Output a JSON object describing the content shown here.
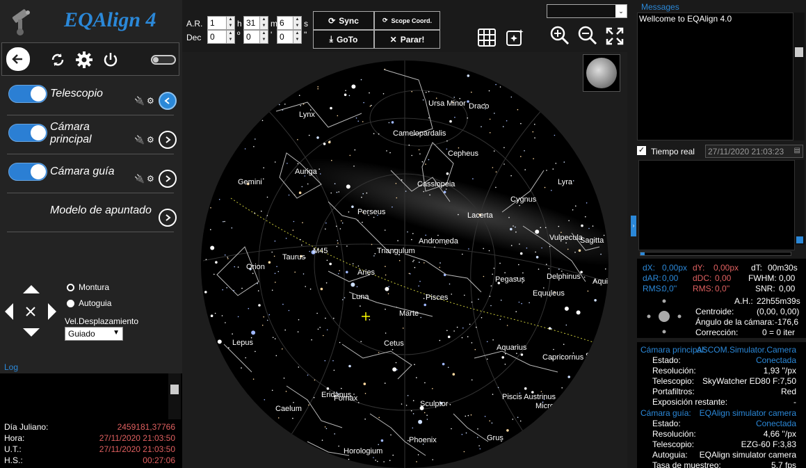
{
  "app": {
    "title": "EQAlign 4"
  },
  "toolbar": {
    "back": "back-icon",
    "refresh": "refresh-icon",
    "settings": "gear-icon",
    "power": "power-icon"
  },
  "devices": [
    {
      "label": "Telescopio",
      "enabled": true
    },
    {
      "label": "Cámara principal",
      "enabled": true
    },
    {
      "label": "Cámara guía",
      "enabled": true
    },
    {
      "label": "Modelo de apuntado"
    }
  ],
  "movement": {
    "option1": "Montura",
    "option2": "Autoguia",
    "speed_label": "Vel.Desplazamiento",
    "speed_value": "Guiado"
  },
  "log": {
    "title": "Log"
  },
  "time_info": [
    {
      "label": "Día Juliano:",
      "value": "2459181,37766"
    },
    {
      "label": "Hora:",
      "value": "27/11/2020 21:03:50"
    },
    {
      "label": "U.T.:",
      "value": "27/11/2020 21:03:50"
    },
    {
      "label": "H.S.:",
      "value": "00:27:06"
    }
  ],
  "coords": {
    "ar_label": "A.R.",
    "dec_label": "Dec",
    "ar_h": "1",
    "ar_h_unit": "h",
    "ar_m": "31",
    "ar_m_unit": "m",
    "ar_s": "6",
    "ar_s_unit": "s",
    "dec_d": "0",
    "dec_d_unit": "º",
    "dec_m": "0",
    "dec_m_unit": "'",
    "dec_s": "0",
    "dec_s_unit": "\""
  },
  "buttons": {
    "sync": "Sync",
    "scope_coord": "Scope Coord.",
    "goto": "GoTo",
    "stop": "Parar!"
  },
  "sky": {
    "labels": [
      "Lynx",
      "Ursa Minor",
      "Draco",
      "Camelopardalis",
      "Cepheus",
      "Auriga",
      "Gemini",
      "Cassiopeia",
      "Lyra",
      "Cygnus",
      "Perseus",
      "Lacerta",
      "Vulpecula",
      "Sagitta",
      "Andromeda",
      "Taurus",
      "M45",
      "Orion",
      "Triangulum",
      "Aries",
      "Pegasus",
      "Delphinus",
      "Aquila",
      "Equuleus",
      "Luna",
      "Pisces",
      "Marte",
      "Lepus",
      "Cetus",
      "Aquarius",
      "Capricornus",
      "Saturn",
      "Eridanus",
      "Fornax",
      "Piscis Austrinus",
      "Caelum",
      "Sculptor",
      "Microscopium",
      "Phoenix",
      "Grus",
      "Horologium"
    ]
  },
  "messages": {
    "title": "Messages",
    "text": "Wellcome to EQAlign 4.0"
  },
  "realtime": {
    "label": "Tiempo real",
    "checked": true,
    "datetime": "27/11/2020 21:03:23"
  },
  "guide_stats": {
    "dx_label": "dX:",
    "dx": "0,00px",
    "dy_label": "dY:",
    "dy": "0,00px",
    "dt_label": "dT:",
    "dt": "00m30s",
    "dar_label": "dAR:",
    "dar": "0,00",
    "ddc_label": "dDC:",
    "ddc": "0,00",
    "fwhm_label": "FWHM:",
    "fwhm": "0,00",
    "rms1_label": "RMS:",
    "rms1": "0,0''",
    "rms2_label": "RMS:",
    "rms2": "0,0''",
    "snr_label": "SNR:",
    "snr": "0,00",
    "ah_label": "A.H.:",
    "ah": "22h55m39s",
    "centroid_label": "Centroide:",
    "centroid": "(0,00, 0,00)",
    "angle_label": "Ángulo de la cámara:",
    "angle": "-176,6",
    "correction_label": "Corrección:",
    "correction": "0 = 0 iter"
  },
  "main_camera": {
    "title": "Cámara principal:",
    "name": "ASCOM.Simulator.Camera",
    "rows": [
      {
        "label": "Estado:",
        "value": "Conectada"
      },
      {
        "label": "Resolución:",
        "value": "1,93 ''/px"
      },
      {
        "label": "Telescopio:",
        "value": "SkyWatcher ED80 F:7,50"
      },
      {
        "label": "Portafiltros:",
        "value": "Red"
      },
      {
        "label": "Exposición restante:",
        "value": "-"
      }
    ]
  },
  "guide_camera": {
    "title": "Cámara guía:",
    "name": "EQAlign simulator camera",
    "rows": [
      {
        "label": "Estado:",
        "value": "Conectada"
      },
      {
        "label": "Resolución:",
        "value": "4,66 ''/px"
      },
      {
        "label": "Telescopio:",
        "value": "EZG-60 F:3,83"
      },
      {
        "label": "Autoguia:",
        "value": "EQAlign simulator camera"
      },
      {
        "label": "Tasa de muestreo:",
        "value": "5,7 fps"
      }
    ]
  },
  "colors": {
    "accent": "#2b88d8",
    "alert": "#e06060",
    "background": "#1a1a1a"
  }
}
